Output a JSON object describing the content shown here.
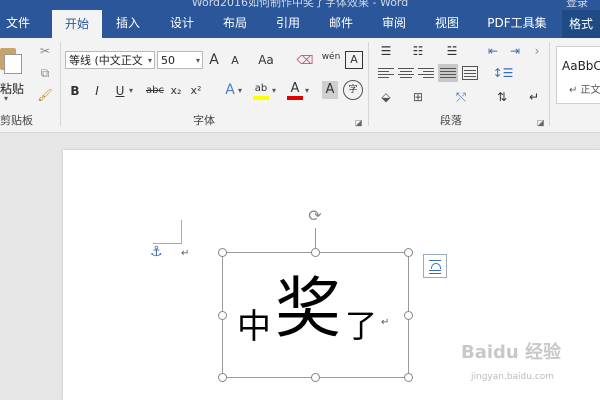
{
  "window": {
    "title": "Word2016如何制作中奖了字体效果 - Word",
    "right_label": "登录"
  },
  "tabs": [
    {
      "label": "文件"
    },
    {
      "label": "开始",
      "active": true
    },
    {
      "label": "插入"
    },
    {
      "label": "设计"
    },
    {
      "label": "布局"
    },
    {
      "label": "引用"
    },
    {
      "label": "邮件"
    },
    {
      "label": "审阅"
    },
    {
      "label": "视图"
    },
    {
      "label": "PDF工具集"
    },
    {
      "label": "格式"
    }
  ],
  "clipboard": {
    "paste_label": "粘贴",
    "group_label": "剪贴板"
  },
  "font": {
    "name_value": "等线 (中文正文",
    "size_value": "50",
    "group_label": "字体",
    "grow_label": "A",
    "shrink_label": "A",
    "case_label": "Aa",
    "phonetic_label": "wén",
    "bold_label": "B",
    "italic_label": "I",
    "underline_label": "U",
    "strike_label": "abc",
    "sub_label": "x₂",
    "sup_label": "x²",
    "effects_label": "A",
    "highlight_label": "ab",
    "color_label": "A",
    "shade_label": "A",
    "enclose_label": "字",
    "border_label": "A",
    "highlight_color": "#ffff00",
    "font_color": "#e00000"
  },
  "paragraph": {
    "group_label": "段落"
  },
  "styles": {
    "preview_label": "AaBbC",
    "preview_sub": "↵ 正文"
  },
  "document": {
    "text_before": "中",
    "text_big": "奖",
    "text_after": "了",
    "para_mark": "↵"
  },
  "watermark": {
    "brand": "Baidu 经验",
    "url": "jingyan.baidu.com"
  }
}
